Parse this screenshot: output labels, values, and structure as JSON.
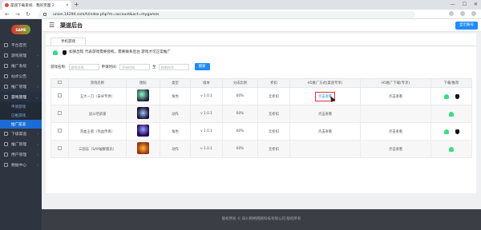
{
  "browser": {
    "tab_title": "渠道下载系统 · 我的页面 2",
    "url": "union.14294.com/h/index.php?m=account&act=mygames"
  },
  "sidebar": {
    "logo_text": "GAME",
    "items": [
      {
        "label": "平台首页"
      },
      {
        "label": "游戏管理"
      },
      {
        "label": "推广系统"
      },
      {
        "label": "站点公告"
      },
      {
        "label": "推广管理"
      },
      {
        "label": "游戏管理",
        "open": true,
        "children": [
          {
            "label": "申请游戏"
          },
          {
            "label": "已推游戏"
          },
          {
            "label": "推广渠道",
            "active": true
          }
        ]
      },
      {
        "label": "下级渠道"
      },
      {
        "label": "推广管理"
      },
      {
        "label": "用户管理"
      },
      {
        "label": "数据中心"
      }
    ]
  },
  "header": {
    "title": "渠道后台",
    "account_button": "显示账号"
  },
  "content": {
    "tab": "手机游戏",
    "notice": "如果出现 代表游戏需要授权，需要联系后台 游戏才可正常推广",
    "filters": {
      "name_label": "游戏名称:",
      "name_placeholder": "游戏名称",
      "time_label": "申请时间:",
      "start_placeholder": "开始时间",
      "separator": "至",
      "end_placeholder": "结束时间",
      "search_button": "搜索"
    },
    "table": {
      "headers": [
        "",
        "游戏名称",
        "图标",
        "类型",
        "版本",
        "分成比例",
        "折扣",
        "H5推广方式(渠道专享)",
        "H5推广下载(专享)",
        "下载/推荐"
      ],
      "rows": [
        {
          "name": "五大一刀（安卓专供）",
          "type": "角色",
          "version": "v 1.0.1",
          "ratio": "60%",
          "discount": "无折扣",
          "promo": "点击查看",
          "download": "点击查看",
          "android": true,
          "ios": true,
          "highlight": true
        },
        {
          "name": "战斗吧武魂",
          "type": "动作",
          "version": "v 1.0.1",
          "ratio": "60%",
          "discount": "无折扣",
          "promo": "点击查看",
          "download": "",
          "android": true,
          "ios": false,
          "highlight": false
        },
        {
          "name": "热血王者（热血传奇）",
          "type": "角色",
          "version": "v 1.0.1",
          "ratio": "60%",
          "discount": "无折扣",
          "promo": "点击查看",
          "download": "点击查看",
          "android": true,
          "ios": true,
          "highlight": false
        },
        {
          "name": "三国志（SAY破解版充）",
          "type": "动作",
          "version": "v 1.0.1",
          "ratio": "60%",
          "discount": "无折扣",
          "promo": "",
          "download": "点击查看",
          "android": true,
          "ios": false,
          "highlight": false
        }
      ]
    }
  },
  "footer": {
    "text": "版权所有 © 四川网络网络科技有限公司 版权所有"
  }
}
